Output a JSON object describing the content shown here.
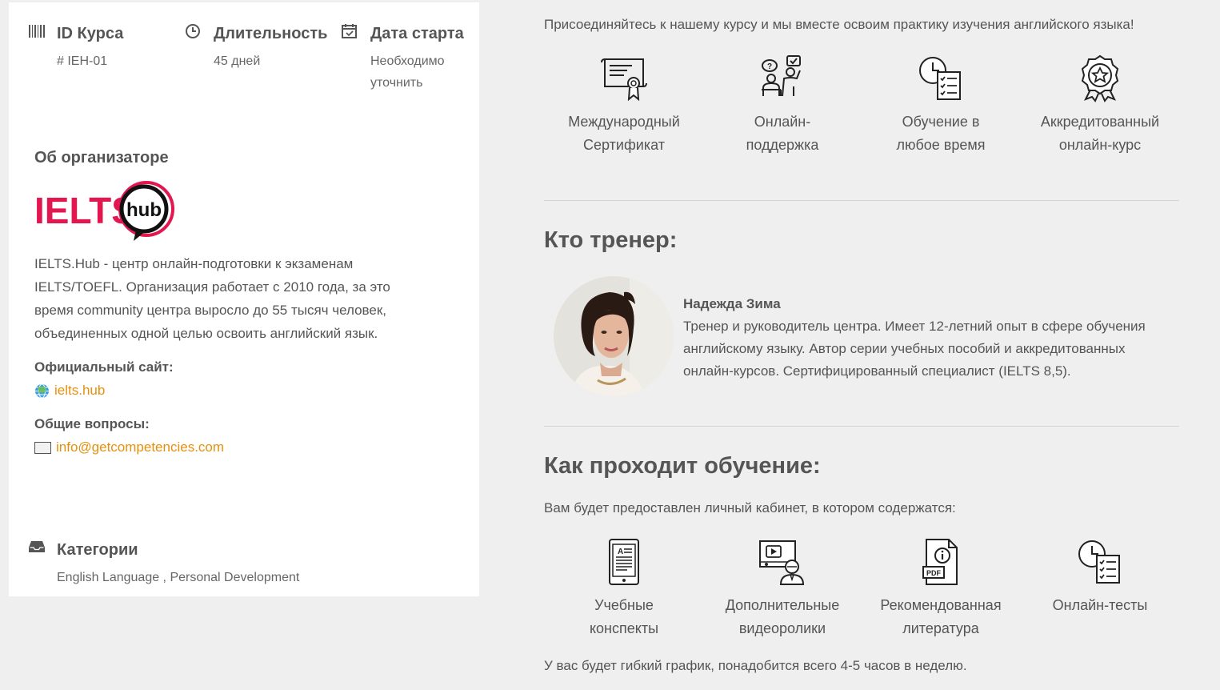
{
  "course": {
    "id_label": "ID Курса",
    "id_value": "# IEH-01",
    "duration_label": "Длительность",
    "duration_value": "45 дней",
    "start_label": "Дата старта",
    "start_value_line1": "Необходимо",
    "start_value_line2": "уточнить"
  },
  "organizer": {
    "title": "Об организаторе",
    "logo_text": "IELTS",
    "logo_bubble": "hub",
    "description": "IELTS.Hub - центр онлайн-подготовки к экзаменам IELTS/TOEFL. Организация работает с 2010 года, за это время community центра выросло до 55 тысяч человек, объединенных одной целью освоить английский язык.",
    "site_label": "Официальный сайт:",
    "site_link": "ielts.hub",
    "questions_label": "Общие вопросы:",
    "email_link": "info@getcompetencies.com"
  },
  "categories": {
    "label": "Категории",
    "value": "English Language , Personal Development"
  },
  "intro": "Присоединяйтесь к нашему курсу и мы вместе освоим практику изучения английского языка!",
  "features": [
    {
      "line1": "Международный",
      "line2": "Сертификат",
      "icon": "certificate-icon"
    },
    {
      "line1": "Онлайн-",
      "line2": "поддержка",
      "icon": "support-icon"
    },
    {
      "line1": "Обучение в",
      "line2": "любое время",
      "icon": "clock-checklist-icon"
    },
    {
      "line1": "Аккредитованный",
      "line2": "онлайн-курс",
      "icon": "award-icon"
    }
  ],
  "trainer": {
    "heading": "Кто тренер:",
    "name": "Надежда Зима",
    "description": "Тренер и руководитель центра. Имеет 12-летний опыт в сфере обучения английскому языку. Автор серии учебных пособий и аккредитованных онлайн-курсов. Сертифицированный специалист (IELTS 8,5)."
  },
  "learning": {
    "heading": "Как проходит обучение:",
    "intro": "Вам будет предоставлен личный кабинет, в котором содержатся:",
    "items": [
      {
        "line1": "Учебные",
        "line2": "конспекты",
        "icon": "ebook-icon"
      },
      {
        "line1": "Дополнительные",
        "line2": "видеоролики",
        "icon": "video-lesson-icon"
      },
      {
        "line1": "Рекомендованная",
        "line2": "литература",
        "icon": "pdf-info-icon"
      },
      {
        "line1": "Онлайн-тесты",
        "line2": "",
        "icon": "clock-checklist-icon"
      }
    ],
    "schedule": "У вас будет гибкий график, понадобится всего 4-5 часов в неделю."
  },
  "colors": {
    "accent_link": "#e8900c",
    "logo_red": "#e3174f",
    "page_bg": "#efefef",
    "card_bg": "#ffffff"
  }
}
